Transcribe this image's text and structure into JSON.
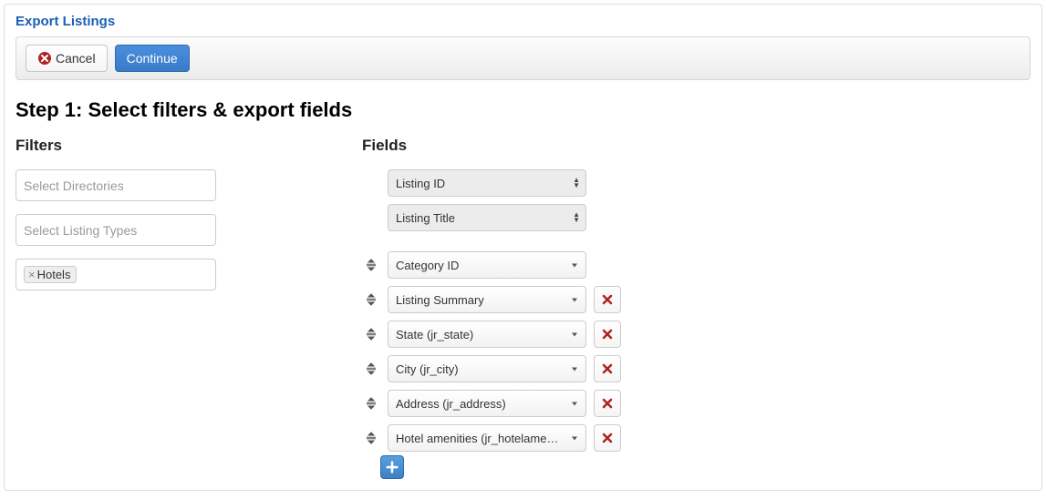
{
  "pageTitle": "Export Listings",
  "toolbar": {
    "cancel_label": "Cancel",
    "continue_label": "Continue"
  },
  "stepHeading": "Step 1: Select filters & export fields",
  "filters": {
    "heading": "Filters",
    "directories_placeholder": "Select Directories",
    "listing_types_placeholder": "Select Listing Types",
    "tags": [
      {
        "label": "Hotels"
      }
    ]
  },
  "fields": {
    "heading": "Fields",
    "fixed": [
      {
        "label": "Listing ID"
      },
      {
        "label": "Listing Title"
      }
    ],
    "sortable": [
      {
        "label": "Category ID",
        "removable": false
      },
      {
        "label": "Listing Summary",
        "removable": true
      },
      {
        "label": "State (jr_state)",
        "removable": true
      },
      {
        "label": "City (jr_city)",
        "removable": true
      },
      {
        "label": "Address (jr_address)",
        "removable": true
      },
      {
        "label": "Hotel amenities (jr_hotelameni…",
        "removable": true
      }
    ]
  }
}
